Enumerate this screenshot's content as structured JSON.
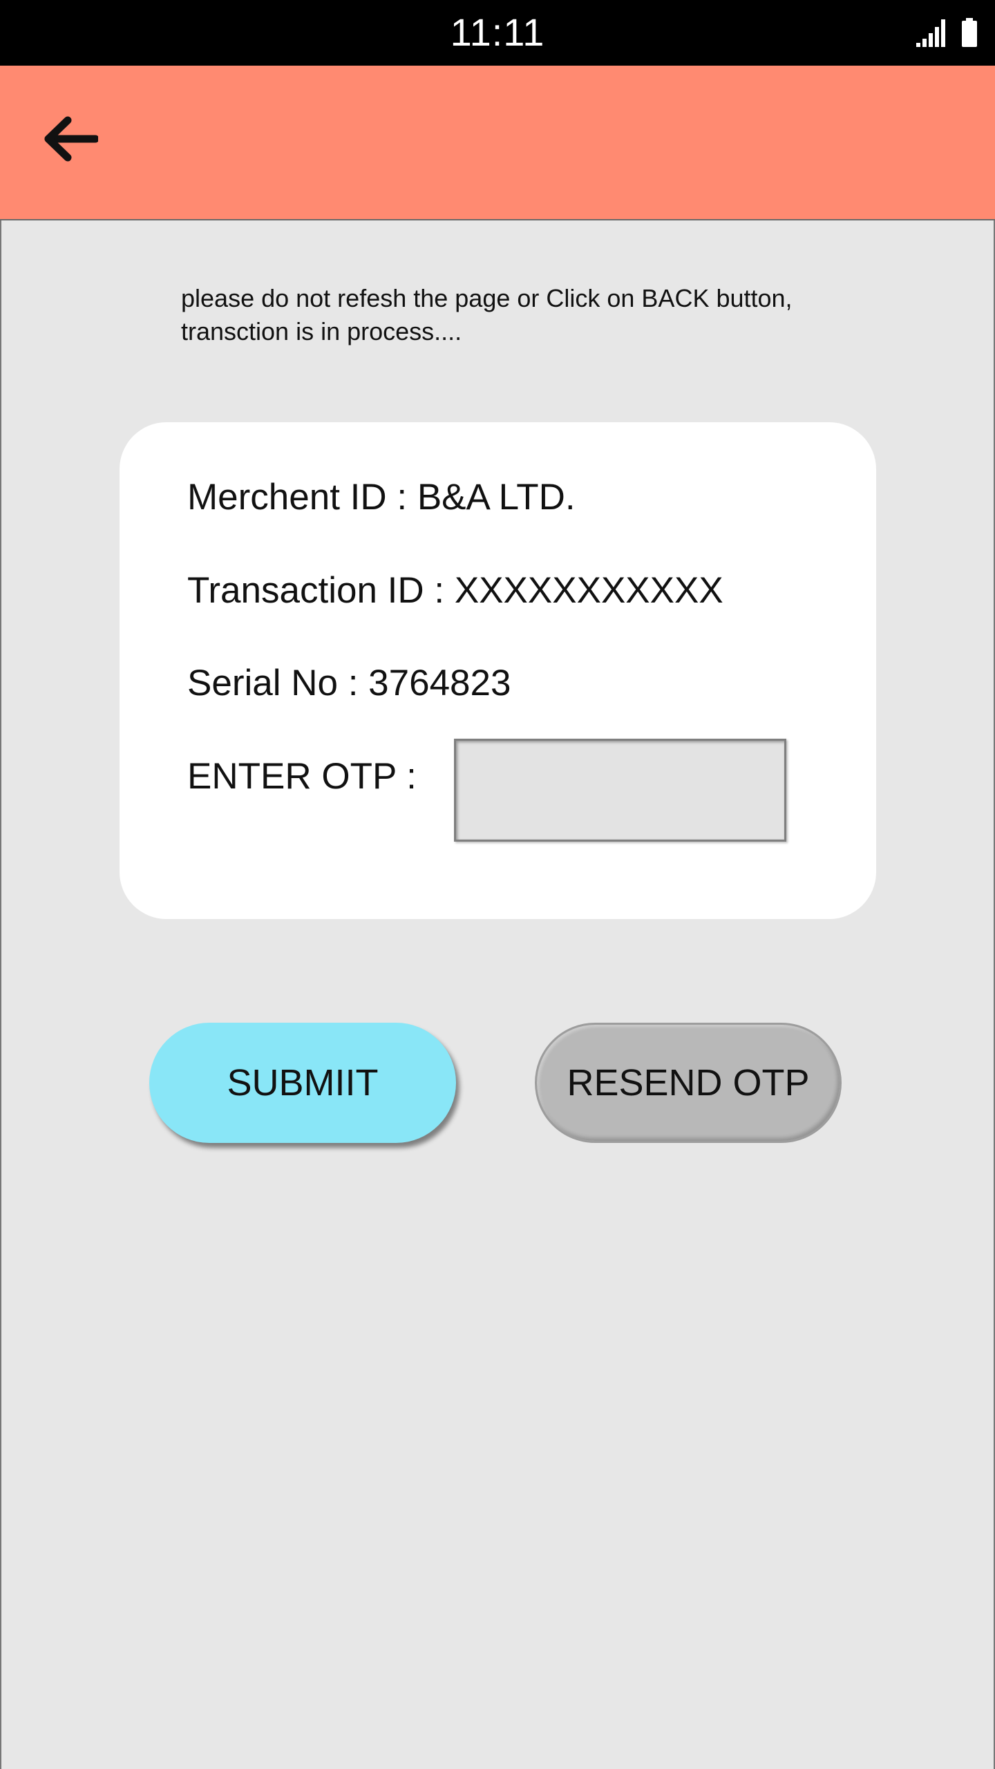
{
  "status_bar": {
    "time": "11:11",
    "icons": [
      "signal-icon",
      "battery-icon"
    ]
  },
  "app_bar": {
    "back_icon": "arrow-left-icon",
    "background": "#ff8a71"
  },
  "notice": {
    "text": "please do not refesh the page or Click on BACK button, transction is in process...."
  },
  "details": {
    "merchant": "Merchent ID : B&A LTD.",
    "transaction": "Transaction ID : XXXXXXXXXXX",
    "serial": "Serial No : 3764823",
    "otp_label": "ENTER OTP :",
    "otp_value": ""
  },
  "buttons": {
    "submit_label": "SUBMIIT",
    "submit_color": "#89e6f7",
    "resend_label": "RESEND OTP",
    "resend_color": "#b8b8b8"
  }
}
